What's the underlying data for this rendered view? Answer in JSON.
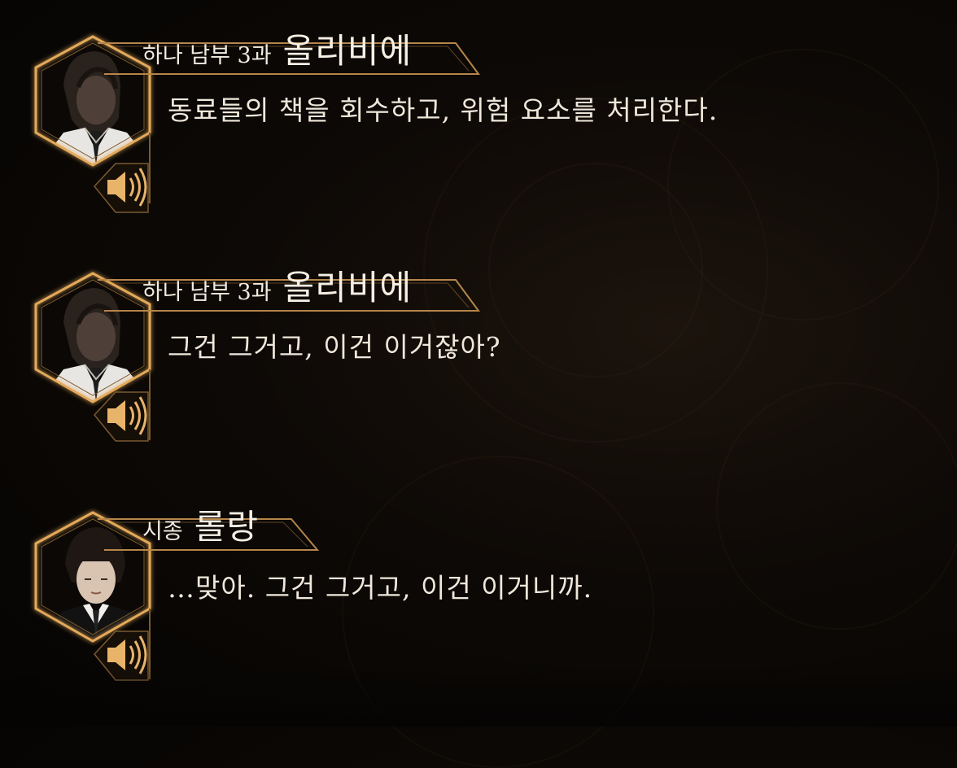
{
  "log": [
    {
      "affiliation": "하나 남부 3과",
      "name": "올리비에",
      "line": "동료들의 책을 회수하고, 위험 요소를 처리한다.",
      "voice_icon": "speaker-icon",
      "portrait": "olivier-portrait"
    },
    {
      "affiliation": "하나 남부 3과",
      "name": "올리비에",
      "line": "그건 그거고, 이건 이거잖아?",
      "voice_icon": "speaker-icon",
      "portrait": "olivier-portrait"
    },
    {
      "affiliation": "시종",
      "name": "롤랑",
      "line": "…맞아. 그건 그거고, 이건 이거니까.",
      "voice_icon": "speaker-icon",
      "portrait": "roland-portrait"
    }
  ],
  "colors": {
    "frame_gold": "#c9984f",
    "frame_glow": "#e3a95a",
    "text": "#efe7da",
    "background": "#0a0705"
  }
}
